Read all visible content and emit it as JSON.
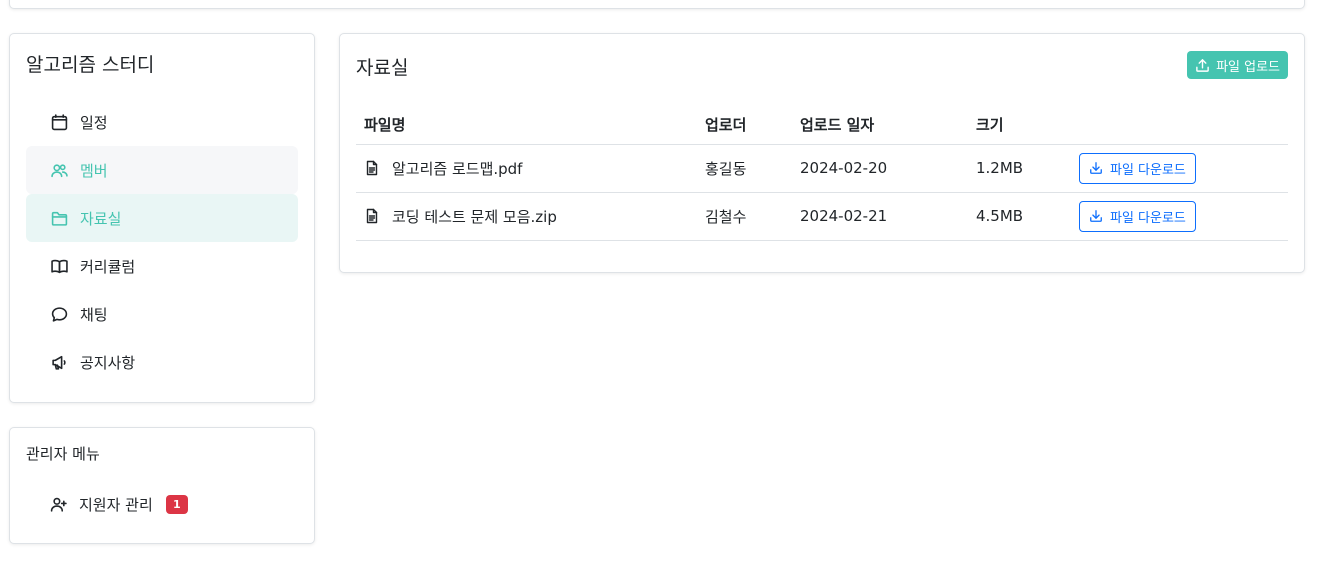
{
  "sidebar": {
    "title": "알고리즘 스터디",
    "items": [
      {
        "label": "일정",
        "icon": "calendar-icon"
      },
      {
        "label": "멤버",
        "icon": "users-icon"
      },
      {
        "label": "자료실",
        "icon": "folder-icon"
      },
      {
        "label": "커리큘럼",
        "icon": "book-icon"
      },
      {
        "label": "채팅",
        "icon": "chat-icon"
      },
      {
        "label": "공지사항",
        "icon": "megaphone-icon"
      }
    ]
  },
  "admin": {
    "title": "관리자 메뉴",
    "item_label": "지원자 관리",
    "badge_count": "1"
  },
  "main": {
    "title": "자료실",
    "upload_label": "파일 업로드",
    "columns": [
      "파일명",
      "업로더",
      "업로드 일자",
      "크기"
    ],
    "rows": [
      {
        "name": "알고리즘 로드맵.pdf",
        "uploader": "홍길동",
        "date": "2024-02-20",
        "size": "1.2MB"
      },
      {
        "name": "코딩 테스트 문제 모음.zip",
        "uploader": "김철수",
        "date": "2024-02-21",
        "size": "4.5MB"
      }
    ],
    "download_label": "파일 다운로드"
  },
  "colors": {
    "accent": "#45c4b0",
    "active_bg": "#e9f6f5",
    "link": "#0d6efd",
    "badge": "#dc3545"
  }
}
